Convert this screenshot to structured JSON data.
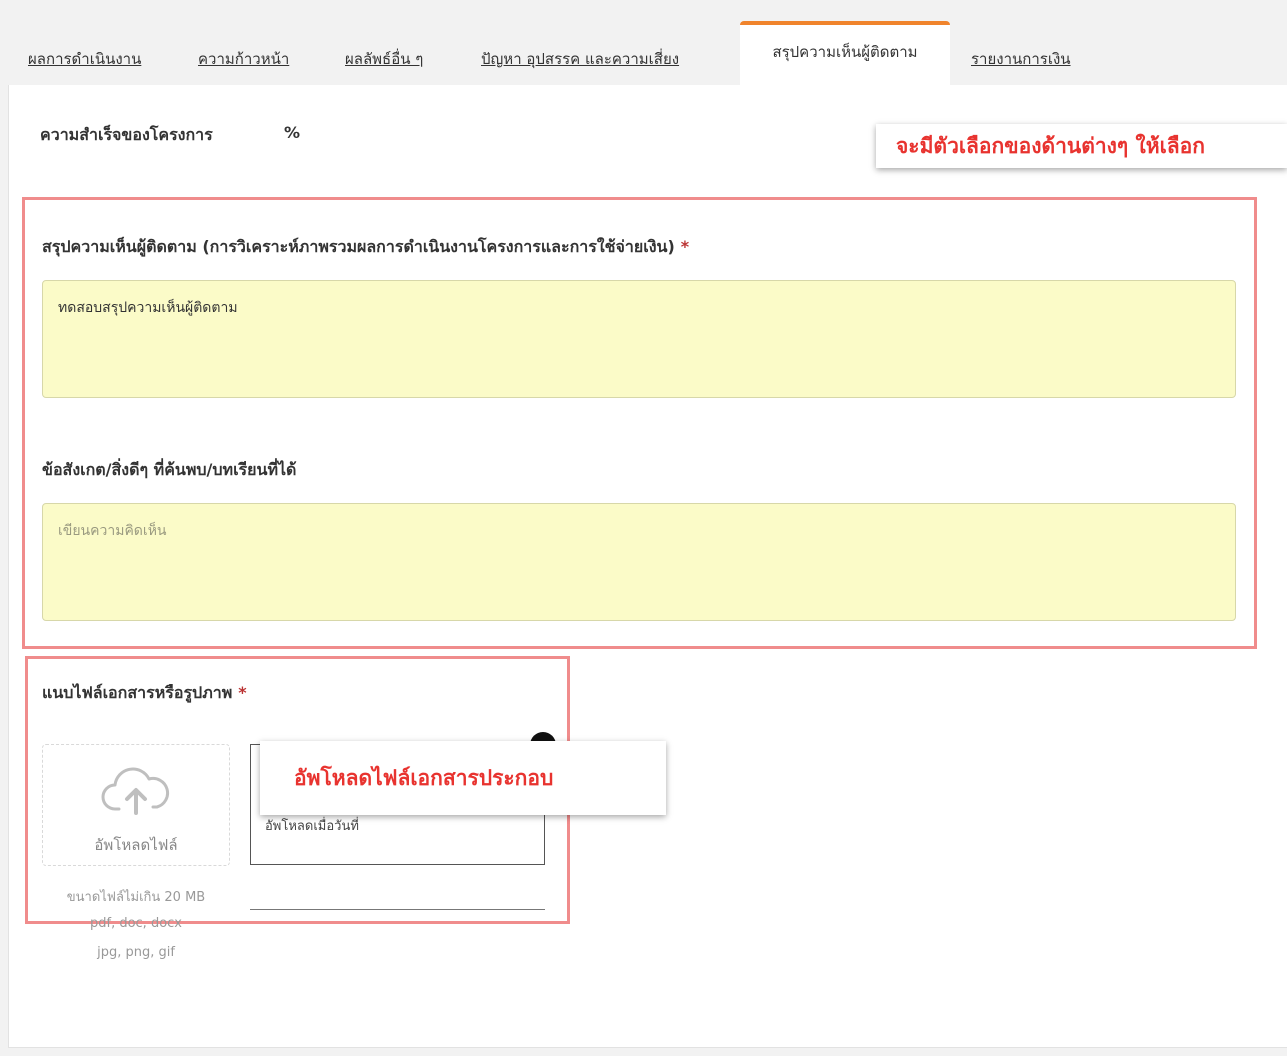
{
  "tabs": [
    {
      "label": "ผลการดำเนินงาน"
    },
    {
      "label": "ความก้าวหน้า"
    },
    {
      "label": "ผลลัพธ์อื่น ๆ"
    },
    {
      "label": "ปัญหา อุปสรรค และความเสี่ยง"
    },
    {
      "label": "สรุปความเห็นผู้ติดตาม",
      "active": true
    },
    {
      "label": "รายงานการเงิน"
    }
  ],
  "success": {
    "label": "ความสำเร็จของโครงการ",
    "value": "%"
  },
  "callouts": {
    "options": "จะมีตัวเลือกของด้านต่างๆ ให้เลือก",
    "upload": "อัพโหลดไฟล์เอกสารประกอบ"
  },
  "summary": {
    "label": "สรุปความเห็นผู้ติดตาม (การวิเคราะห์ภาพรวมผลการดำเนินงานโครงการและการใช้จ่ายเงิน)",
    "required": "*",
    "value": "ทดสอบสรุปความเห็นผู้ติดตาม"
  },
  "observations": {
    "label": "ข้อสังเกต/สิ่งดีๆ ที่ค้นพบ/บทเรียนที่ได้",
    "value": "",
    "placeholder": "เขียนความคิดเห็น"
  },
  "attachment": {
    "label": "แนบไฟล์เอกสารหรือรูปภาพ",
    "required": "*",
    "upload_label": "อัพโหลดไฟล์",
    "hint_size": "ขนาดไฟล์ไม่เกิน 20 MB",
    "hint_types_1": "pdf, doc, docx",
    "hint_types_2": "jpg, png, gif",
    "file_date_text": "อัพโหลดเมื่อวันที่"
  },
  "colors": {
    "accent": "#f0842c",
    "highlight_border": "#f08c8c",
    "callout_text": "#e8332f",
    "textarea_bg": "#fbfbc8"
  }
}
